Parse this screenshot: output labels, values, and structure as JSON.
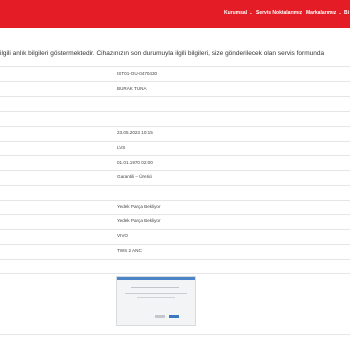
{
  "nav": {
    "items": [
      {
        "label": "Kurumsal",
        "caret": "⌄"
      },
      {
        "label": "Servis Noktalarımız",
        "caret": ""
      },
      {
        "label": "Markalarımız",
        "caret": "⌄"
      },
      {
        "label": "Bi",
        "caret": ""
      }
    ]
  },
  "intro_text": "ilgili anlık bilgileri göstermektedir. Cihazınızın son durumuyla ilgili bilgileri, size gönderilecek olan servis formunda",
  "values": [
    "IST01-OU-0470430",
    "BURAK TUNA",
    "23.05.2023 10:15",
    "LVS",
    "01.01.1970 02:00",
    "Garantili – Üretici",
    "Yedek Parça Bekliyor",
    "Yedek Parça Bekliyor",
    "VIVO",
    "TWS 2 ANC"
  ],
  "colors": {
    "brand_red": "#e31c25"
  }
}
